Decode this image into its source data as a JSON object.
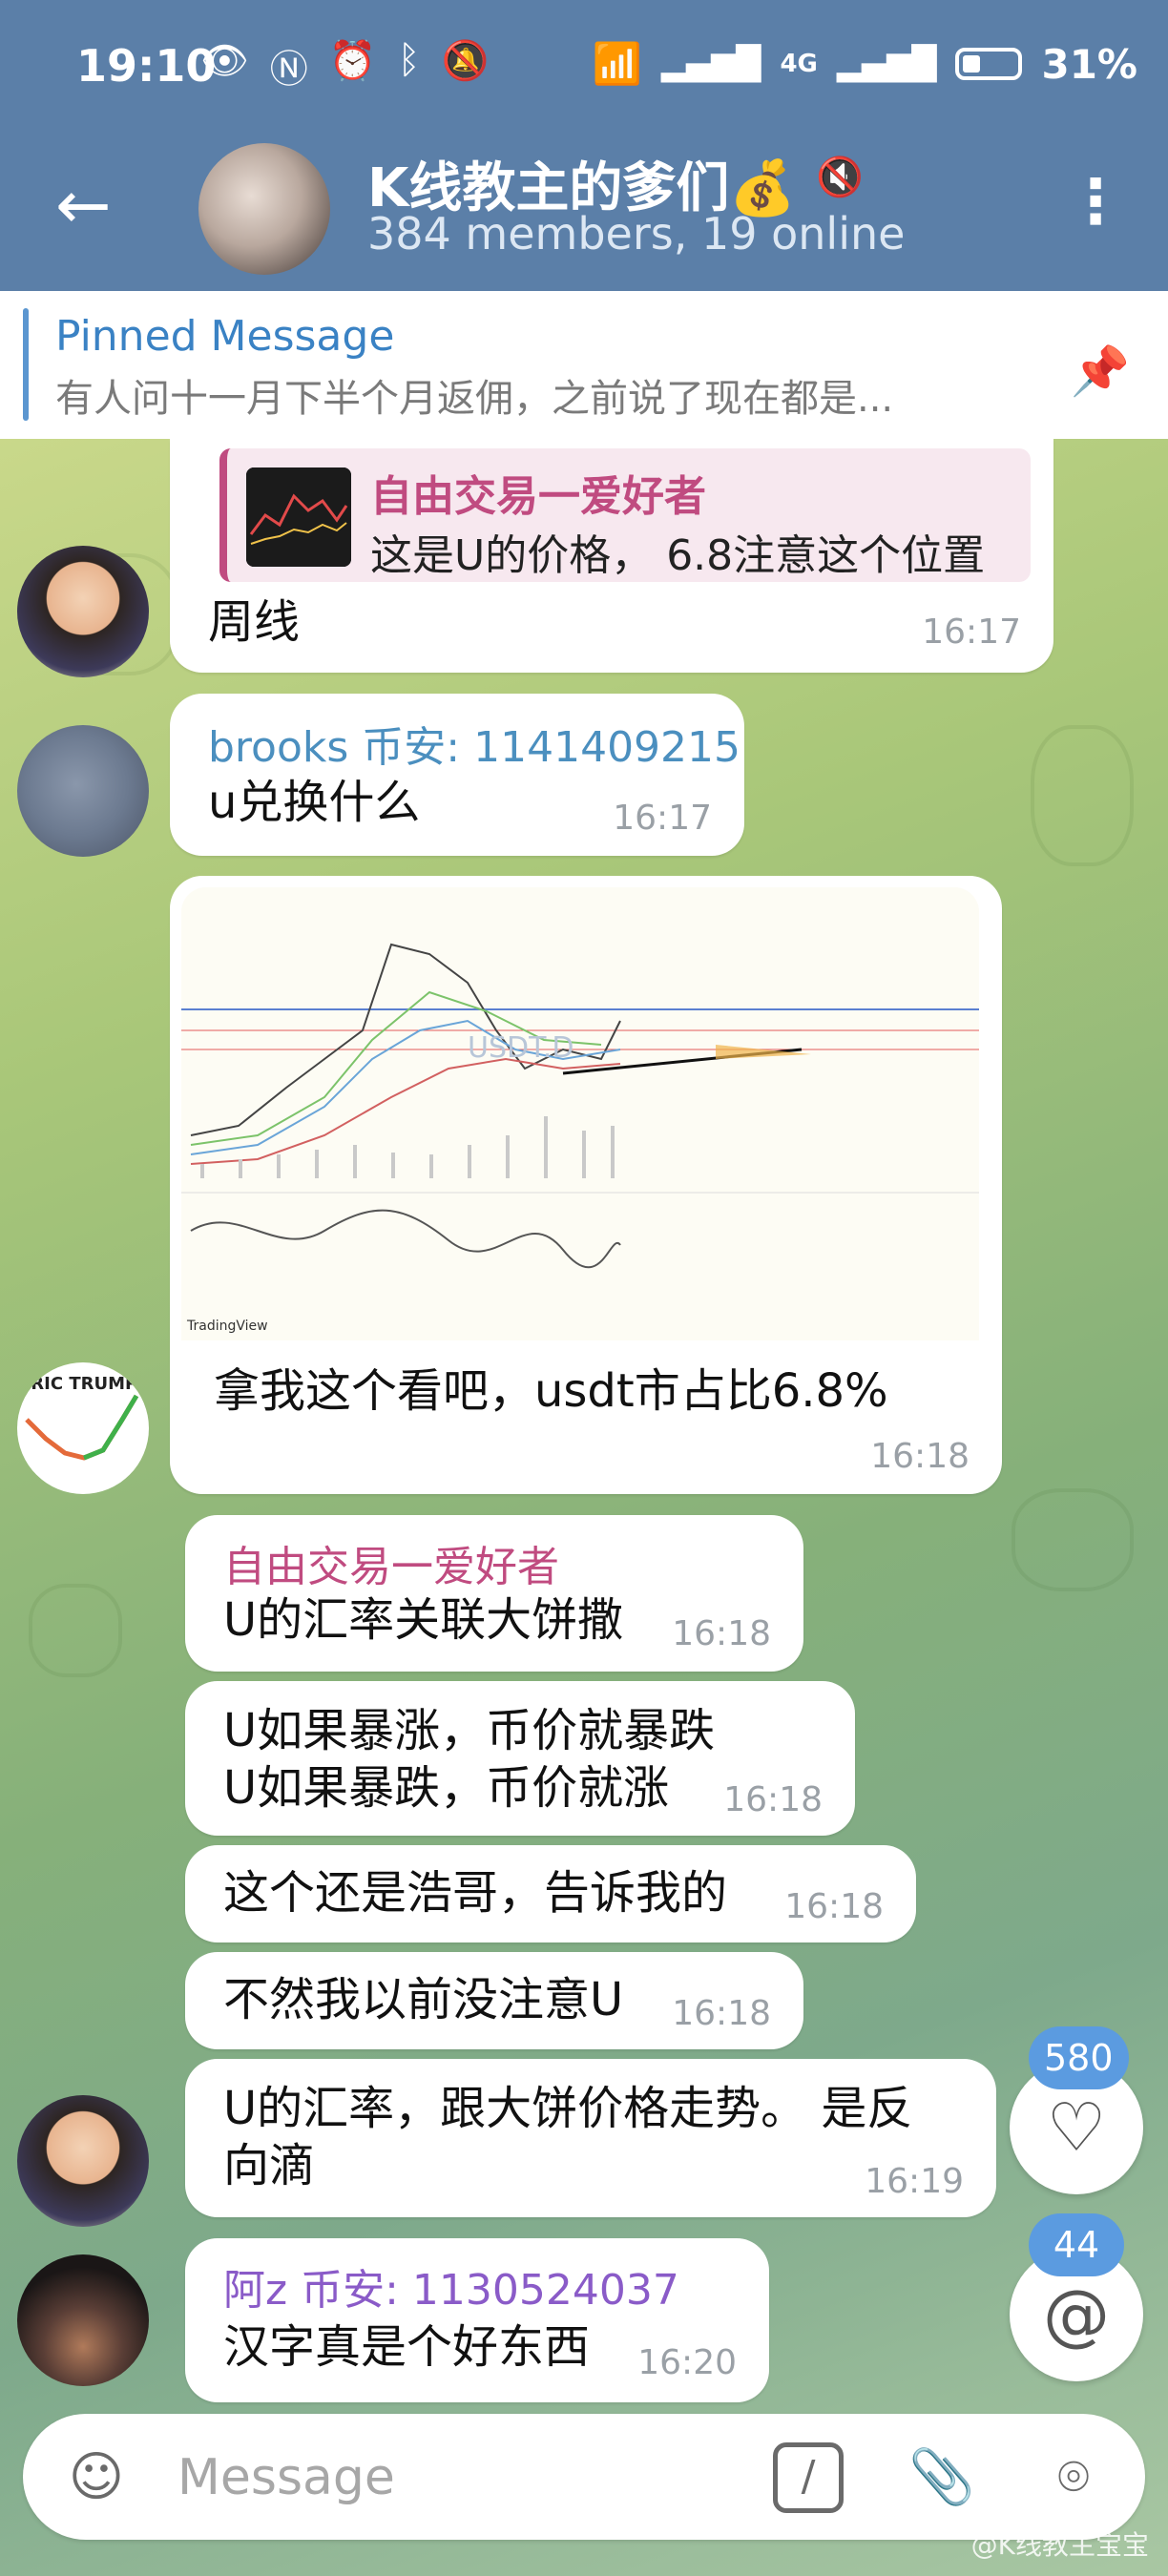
{
  "statusbar": {
    "time": "19:10",
    "network": "4G",
    "battery": "31%"
  },
  "header": {
    "title": "K线教主的爹们💰",
    "subtitle": "384 members, 19 online"
  },
  "pinned": {
    "title": "Pinned Message",
    "text": "有人问十一月下半个月返佣，之前说了现在都是..."
  },
  "messages": [
    {
      "reply_sender": "自由交易一爱好者",
      "reply_text": "这是U的价格，  6.8注意这个位置",
      "text": "周线",
      "time": "16:17"
    },
    {
      "sender": "brooks 币安: 1141409215",
      "text": "u兑换什么",
      "time": "16:17"
    },
    {
      "text": "拿我这个看吧，usdt市占比6.8%",
      "time": "16:18",
      "chart_brand": "TradingView",
      "chart_watermark": "USDT.D"
    },
    {
      "sender": "自由交易一爱好者",
      "text": "U的汇率关联大饼撒",
      "time": "16:18"
    },
    {
      "text1": "U如果暴涨，币价就暴跌",
      "text2": "U如果暴跌，币价就涨",
      "time": "16:18"
    },
    {
      "text": "这个还是浩哥，告诉我的",
      "time": "16:18"
    },
    {
      "text": "不然我以前没注意U",
      "time": "16:18"
    },
    {
      "text1": "U的汇率，跟大饼价格走势。 是反",
      "text2": "向滴",
      "time": "16:19"
    },
    {
      "sender": "阿z 币安: 1130524037",
      "text": "汉字真是个好东西",
      "time": "16:20"
    }
  ],
  "avatar_labels": {
    "eric": "ERIC TRUMP"
  },
  "fabs": {
    "reactions_count": "580",
    "mentions_count": "44"
  },
  "composer": {
    "placeholder": "Message"
  },
  "watermark": "@K线教主宝宝",
  "colors": {
    "header": "#5b7fa8",
    "accent": "#3a82c4",
    "sender_pink": "#c04b80",
    "sender_blue": "#4b8fbf",
    "sender_purple": "#8a5bc8",
    "badge": "#5b9be0"
  }
}
